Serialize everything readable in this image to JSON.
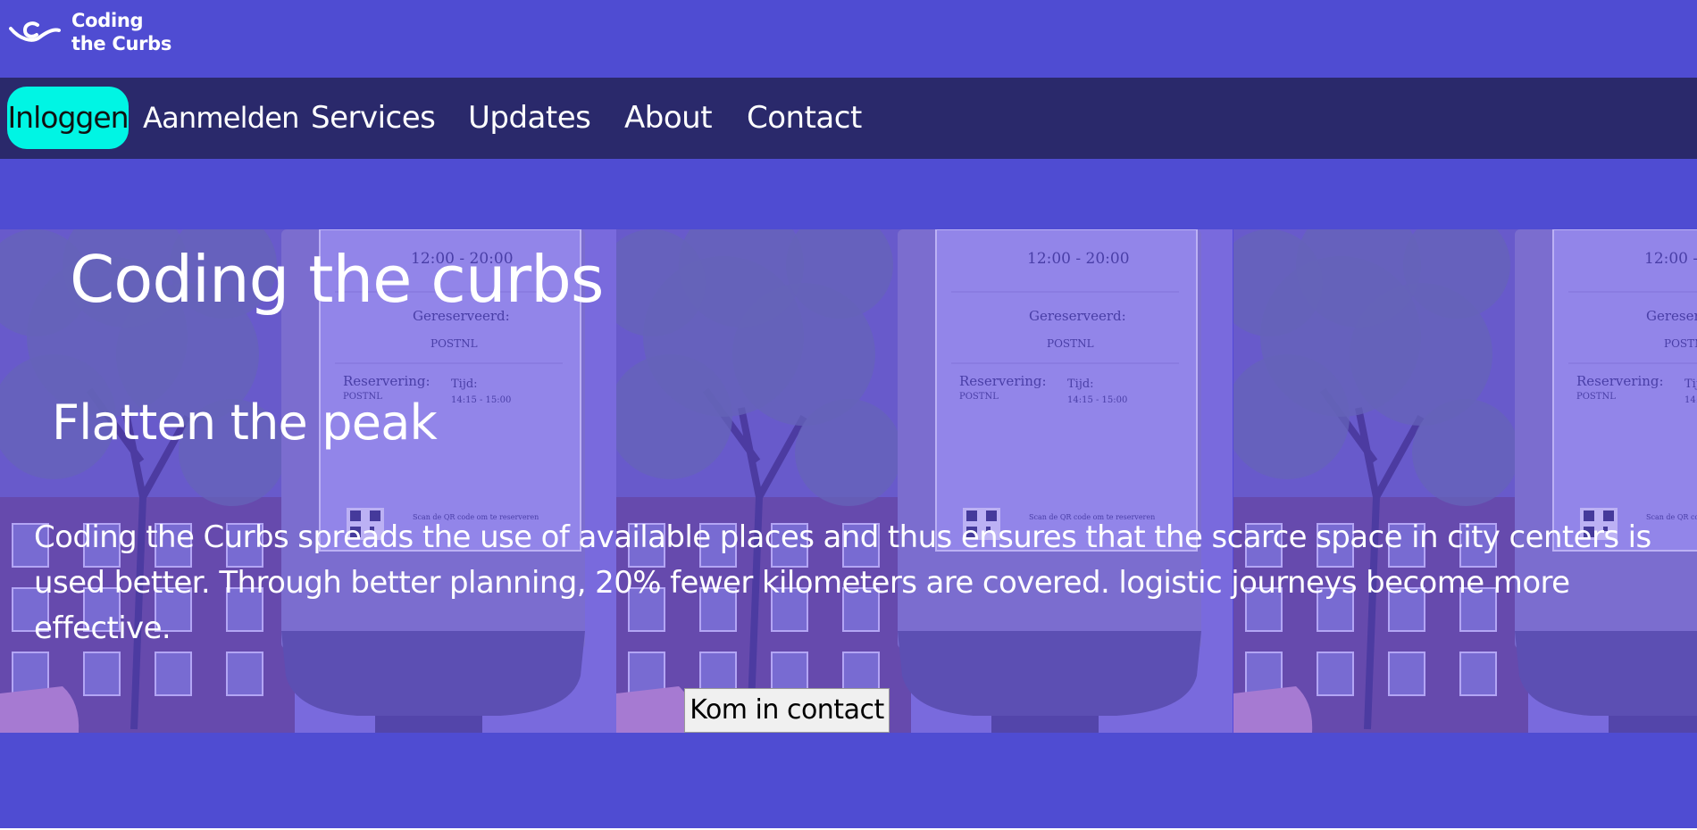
{
  "brand": {
    "line1": "Coding",
    "line2": "the Curbs",
    "logo_icon": "wave-c-logo-icon"
  },
  "nav": {
    "login": "Inloggen",
    "register": "Aanmelden",
    "services": "Services",
    "updates": "Updates",
    "about": "About",
    "contact": "Contact"
  },
  "hero": {
    "title": "Coding the curbs",
    "subtitle": "Flatten the peak",
    "text": "Coding the Curbs spreads the use of available places and thus ensures that the scarce space in city centers is used better. Through better planning, 20% fewer kilometers are covered. logistic journeys become more effective.",
    "cta": "Kom in contact",
    "sign": {
      "time": "12:00 - 20:00",
      "reserved_label": "Gereserveerd:",
      "reserved_value": "POSTNL",
      "reservation_label": "Reservering:",
      "reservation_value": "POSTNL",
      "time_label": "Tijd:",
      "time_value": "14:15 - 15:00",
      "qr_text": "Scan de QR code om te reserveren"
    }
  },
  "colors": {
    "page_bg": "#4f4cd2",
    "nav_bg": "#2a296b",
    "accent": "#00f5e4"
  }
}
